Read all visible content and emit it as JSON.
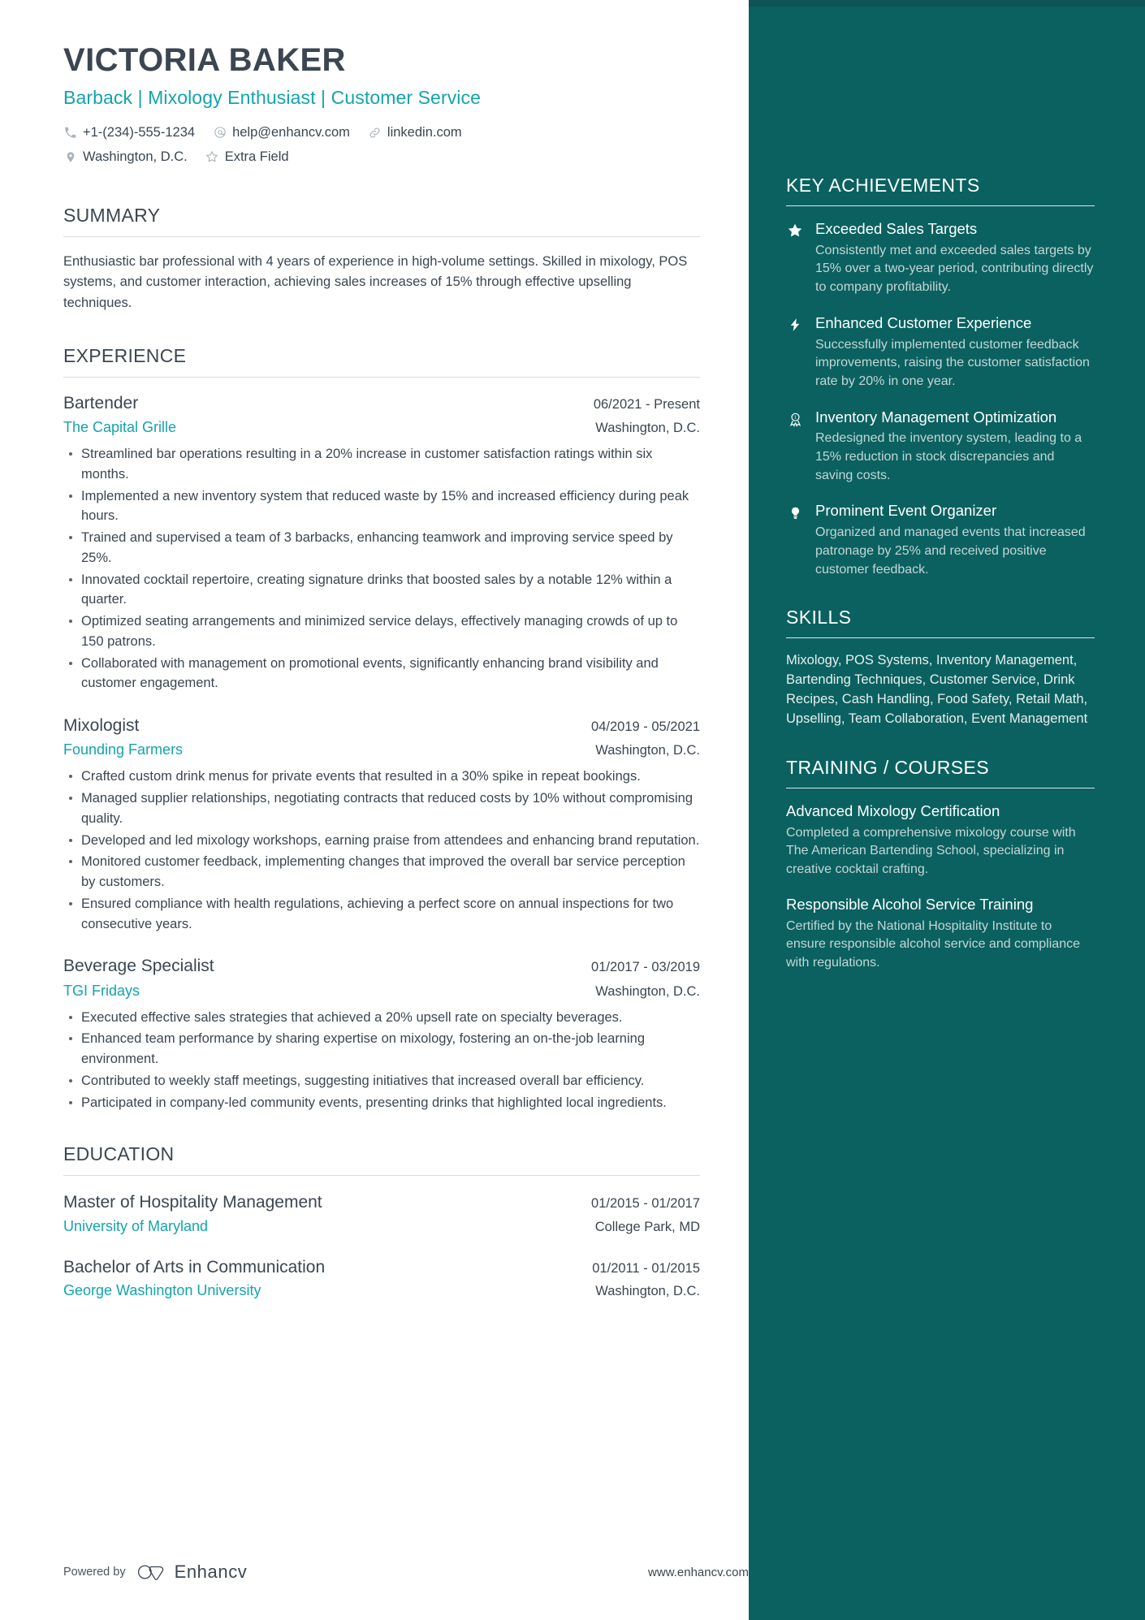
{
  "theme": {
    "accent": "#13a4ac",
    "sidebar_bg": "#0a6160",
    "text": "#3b4652"
  },
  "header": {
    "name": "VICTORIA BAKER",
    "headline": "Barback | Mixology Enthusiast | Customer Service",
    "contacts_row1": [
      {
        "icon": "phone-icon",
        "text": "+1-(234)-555-1234"
      },
      {
        "icon": "email-icon",
        "text": "help@enhancv.com"
      },
      {
        "icon": "link-icon",
        "text": "linkedin.com"
      }
    ],
    "contacts_row2": [
      {
        "icon": "location-pin-icon",
        "text": "Washington, D.C."
      },
      {
        "icon": "star-outline-icon",
        "text": "Extra Field"
      }
    ]
  },
  "summary": {
    "title": "SUMMARY",
    "text": "Enthusiastic bar professional with 4 years of experience in high-volume settings. Skilled in mixology, POS systems, and customer interaction, achieving sales increases of 15% through effective upselling techniques."
  },
  "experience": {
    "title": "EXPERIENCE",
    "jobs": [
      {
        "position": "Bartender",
        "dates": "06/2021 - Present",
        "company": "The Capital Grille",
        "location": "Washington, D.C.",
        "bullets": [
          "Streamlined bar operations resulting in a 20% increase in customer satisfaction ratings within six months.",
          "Implemented a new inventory system that reduced waste by 15% and increased efficiency during peak hours.",
          "Trained and supervised a team of 3 barbacks, enhancing teamwork and improving service speed by 25%.",
          "Innovated cocktail repertoire, creating signature drinks that boosted sales by a notable 12% within a quarter.",
          "Optimized seating arrangements and minimized service delays, effectively managing crowds of up to 150 patrons.",
          "Collaborated with management on promotional events, significantly enhancing brand visibility and customer engagement."
        ]
      },
      {
        "position": "Mixologist",
        "dates": "04/2019 - 05/2021",
        "company": "Founding Farmers",
        "location": "Washington, D.C.",
        "bullets": [
          "Crafted custom drink menus for private events that resulted in a 30% spike in repeat bookings.",
          "Managed supplier relationships, negotiating contracts that reduced costs by 10% without compromising quality.",
          "Developed and led mixology workshops, earning praise from attendees and enhancing brand reputation.",
          "Monitored customer feedback, implementing changes that improved the overall bar service perception by customers.",
          "Ensured compliance with health regulations, achieving a perfect score on annual inspections for two consecutive years."
        ]
      },
      {
        "position": "Beverage Specialist",
        "dates": "01/2017 - 03/2019",
        "company": "TGI Fridays",
        "location": "Washington, D.C.",
        "bullets": [
          "Executed effective sales strategies that achieved a 20% upsell rate on specialty beverages.",
          "Enhanced team performance by sharing expertise on mixology, fostering an on-the-job learning environment.",
          "Contributed to weekly staff meetings, suggesting initiatives that increased overall bar efficiency.",
          "Participated in company-led community events, presenting drinks that highlighted local ingredients."
        ]
      }
    ]
  },
  "education": {
    "title": "EDUCATION",
    "entries": [
      {
        "degree": "Master of Hospitality Management",
        "dates": "01/2015 - 01/2017",
        "school": "University of Maryland",
        "location": "College Park, MD"
      },
      {
        "degree": "Bachelor of Arts in Communication",
        "dates": "01/2011 - 01/2015",
        "school": "George Washington University",
        "location": "Washington, D.C."
      }
    ]
  },
  "achievements": {
    "title": "KEY ACHIEVEMENTS",
    "items": [
      {
        "icon": "star-icon",
        "title": "Exceeded Sales Targets",
        "desc": "Consistently met and exceeded sales targets by 15% over a two-year period, contributing directly to company profitability."
      },
      {
        "icon": "lightning-bolt-icon",
        "title": "Enhanced Customer Experience",
        "desc": "Successfully implemented customer feedback improvements, raising the customer satisfaction rate by 20% in one year."
      },
      {
        "icon": "award-ribbon-icon",
        "title": "Inventory Management Optimization",
        "desc": "Redesigned the inventory system, leading to a 15% reduction in stock discrepancies and saving costs."
      },
      {
        "icon": "lightbulb-icon",
        "title": "Prominent Event Organizer",
        "desc": "Organized and managed events that increased patronage by 25% and received positive customer feedback."
      }
    ]
  },
  "skills": {
    "title": "SKILLS",
    "text": "Mixology, POS Systems, Inventory Management, Bartending Techniques, Customer Service, Drink Recipes, Cash Handling, Food Safety, Retail Math, Upselling, Team Collaboration, Event Management"
  },
  "training": {
    "title": "TRAINING / COURSES",
    "courses": [
      {
        "title": "Advanced Mixology Certification",
        "desc": "Completed a comprehensive mixology course with The American Bartending School, specializing in creative cocktail crafting."
      },
      {
        "title": "Responsible Alcohol Service Training",
        "desc": "Certified by the National Hospitality Institute to ensure responsible alcohol service and compliance with regulations."
      }
    ]
  },
  "footer": {
    "powered_by": "Powered by",
    "brand": "Enhancv",
    "url": "www.enhancv.com"
  }
}
